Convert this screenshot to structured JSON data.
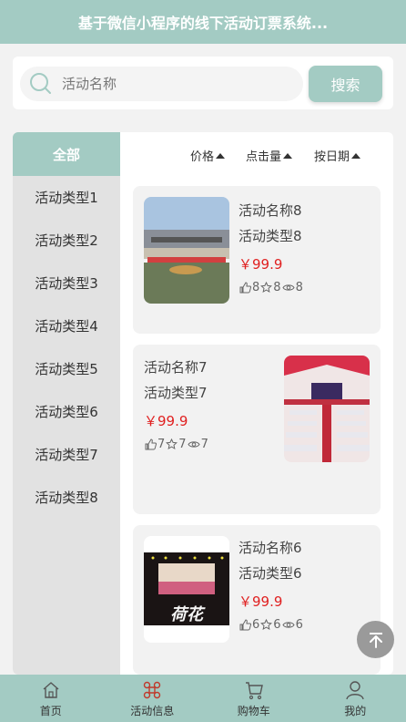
{
  "header": {
    "title": "基于微信小程序的线下活动订票系统..."
  },
  "search": {
    "placeholder": "活动名称",
    "button_label": "搜索"
  },
  "sidebar": {
    "items": [
      {
        "label": "全部",
        "active": true
      },
      {
        "label": "活动类型1"
      },
      {
        "label": "活动类型2"
      },
      {
        "label": "活动类型3"
      },
      {
        "label": "活动类型4"
      },
      {
        "label": "活动类型5"
      },
      {
        "label": "活动类型6"
      },
      {
        "label": "活动类型7"
      },
      {
        "label": "活动类型8"
      }
    ]
  },
  "sort": {
    "price": "价格",
    "clicks": "点击量",
    "date": "按日期"
  },
  "cards": [
    {
      "name": "活动名称8",
      "type": "活动类型8",
      "price": "￥99.9",
      "likes": "8",
      "stars": "8",
      "views": "8"
    },
    {
      "name": "活动名称7",
      "type": "活动类型7",
      "price": "￥99.9",
      "likes": "7",
      "stars": "7",
      "views": "7"
    },
    {
      "name": "活动名称6",
      "type": "活动类型6",
      "price": "￥99.9",
      "likes": "6",
      "stars": "6",
      "views": "6",
      "thumb_text": "荷花"
    }
  ],
  "tabbar": {
    "items": [
      {
        "label": "首页",
        "icon": "home-icon"
      },
      {
        "label": "活动信息",
        "icon": "activity-icon",
        "active": true
      },
      {
        "label": "购物车",
        "icon": "cart-icon"
      },
      {
        "label": "我的",
        "icon": "user-icon"
      }
    ]
  },
  "colors": {
    "accent": "#a3cbc3",
    "price": "#e02020",
    "active_tab_icon": "#c0392b"
  }
}
